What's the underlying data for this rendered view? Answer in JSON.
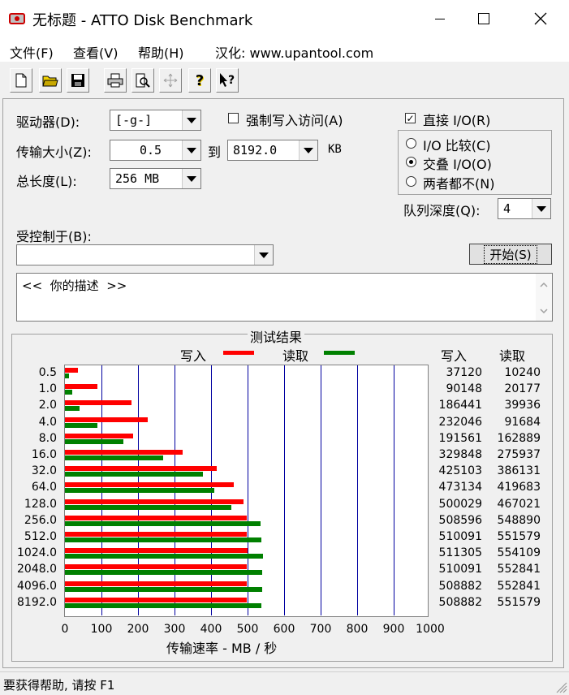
{
  "window": {
    "title": "无标题 - ATTO Disk Benchmark"
  },
  "menu": {
    "file": "文件(F)",
    "view": "查看(V)",
    "help": "帮助(H)",
    "localize": "汉化: www.upantool.com"
  },
  "form": {
    "drive_label": "驱动器(D):",
    "drive_value": "[-g-]",
    "transfer_label": "传输大小(Z):",
    "transfer_min": "0.5",
    "to_label": "到",
    "transfer_max": "8192.0",
    "kb_label": "KB",
    "total_label": "总长度(L):",
    "total_value": "256 MB",
    "force_write_label": "强制写入访问(A)",
    "direct_io_label": "直接 I/O(R)",
    "io_compare_label": "I/O 比较(C)",
    "overlap_io_label": "交叠 I/O(O)",
    "neither_label": "两者都不(N)",
    "queue_label": "队列深度(Q):",
    "queue_value": "4",
    "controlled_label": "受控制于(B):",
    "controlled_value": "",
    "start_label": "开始(S)",
    "desc_value": "<<  你的描述  >>"
  },
  "results": {
    "title": "测试结果",
    "write_header": "写入",
    "read_header": "读取",
    "xaxis_label": "传输速率 - MB / 秒"
  },
  "chart_data": {
    "type": "bar",
    "orientation": "horizontal",
    "categories": [
      "0.5",
      "1.0",
      "2.0",
      "4.0",
      "8.0",
      "16.0",
      "32.0",
      "64.0",
      "128.0",
      "256.0",
      "512.0",
      "1024.0",
      "2048.0",
      "4096.0",
      "8192.0"
    ],
    "series": [
      {
        "name": "写入",
        "color": "#ff0000",
        "values": [
          37120,
          90148,
          186441,
          232046,
          191561,
          329848,
          425103,
          473134,
          500029,
          508596,
          510091,
          511305,
          510091,
          508882,
          508882
        ]
      },
      {
        "name": "读取",
        "color": "#008000",
        "values": [
          10240,
          20177,
          39936,
          91684,
          162889,
          275937,
          386131,
          419683,
          467021,
          548890,
          551579,
          554109,
          552841,
          552841,
          551579
        ]
      }
    ],
    "xticks": [
      "0",
      "100",
      "200",
      "300",
      "400",
      "500",
      "600",
      "700",
      "800",
      "900",
      "1000"
    ],
    "xlim": [
      0,
      1000
    ],
    "xlabel": "传输速率 - MB / 秒",
    "grid": true
  },
  "status": {
    "text": "要获得帮助, 请按 F1"
  }
}
